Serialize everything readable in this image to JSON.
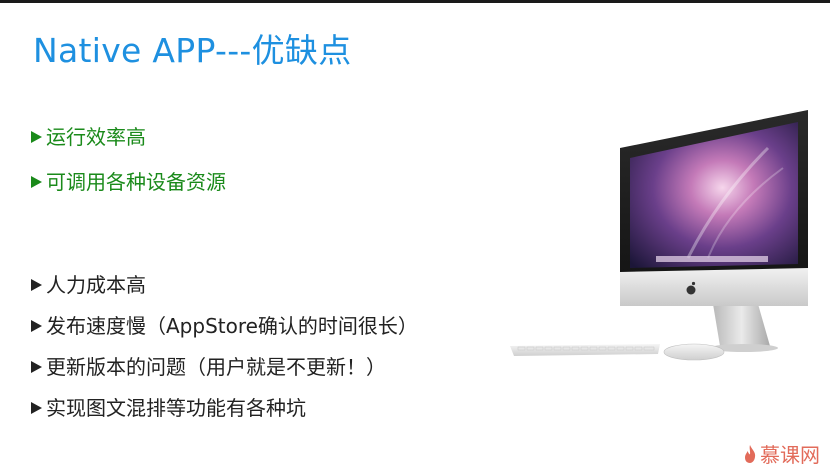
{
  "slide": {
    "title": "Native APP---优缺点"
  },
  "pros": [
    {
      "text": "运行效率高"
    },
    {
      "text": "可调用各种设备资源"
    }
  ],
  "cons": [
    {
      "text": "人力成本高"
    },
    {
      "text": "发布速度慢（AppStore确认的时间很长）"
    },
    {
      "text": "更新版本的问题（用户就是不更新！）"
    },
    {
      "text": "实现图文混排等功能有各种坑"
    }
  ],
  "watermark": {
    "text": "慕课网"
  },
  "colors": {
    "title": "#1e90e0",
    "pros_text": "#1a8a1a",
    "cons_text": "#222222",
    "watermark": "#e26b5a"
  },
  "icons": {
    "bullet": "right-arrow-bullet-icon",
    "device": "imac-computer-illustration",
    "logo": "flame-logo-icon"
  }
}
